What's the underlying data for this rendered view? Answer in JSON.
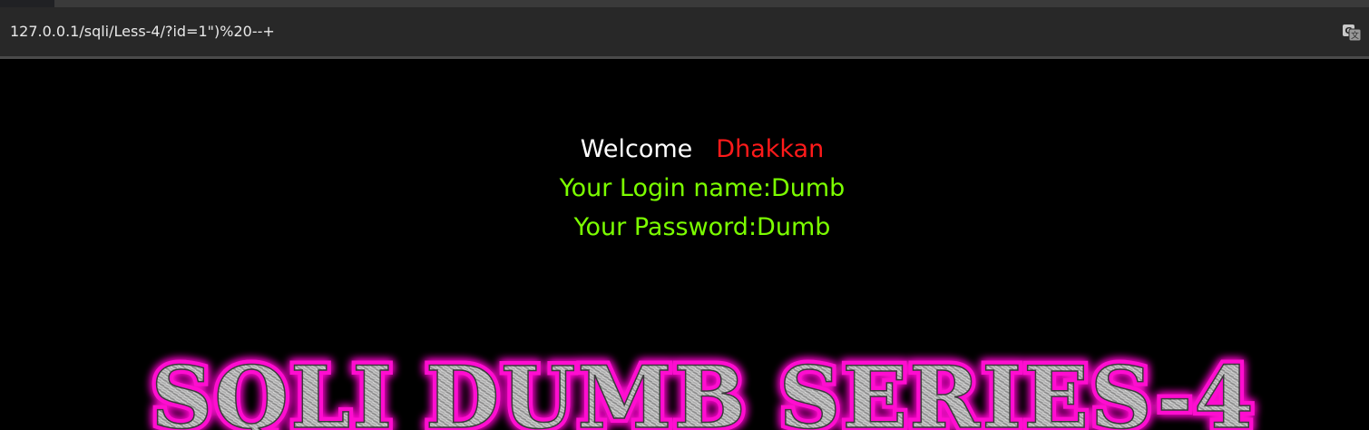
{
  "browser": {
    "url": "127.0.0.1/sqli/Less-4/?id=1\")%20--+",
    "translate_icon": "translate-icon"
  },
  "page": {
    "welcome_label": "Welcome",
    "welcome_name": "Dhakkan",
    "login_line": "Your Login name:Dumb",
    "password_line": "Your Password:Dumb",
    "title_image_text": "SQLI DUMB SERIES-4"
  },
  "colors": {
    "background": "#000000",
    "welcome": "#ffffff",
    "name": "#ff1a1a",
    "result_text": "#7cff00",
    "title_glow": "#ff00cc"
  }
}
